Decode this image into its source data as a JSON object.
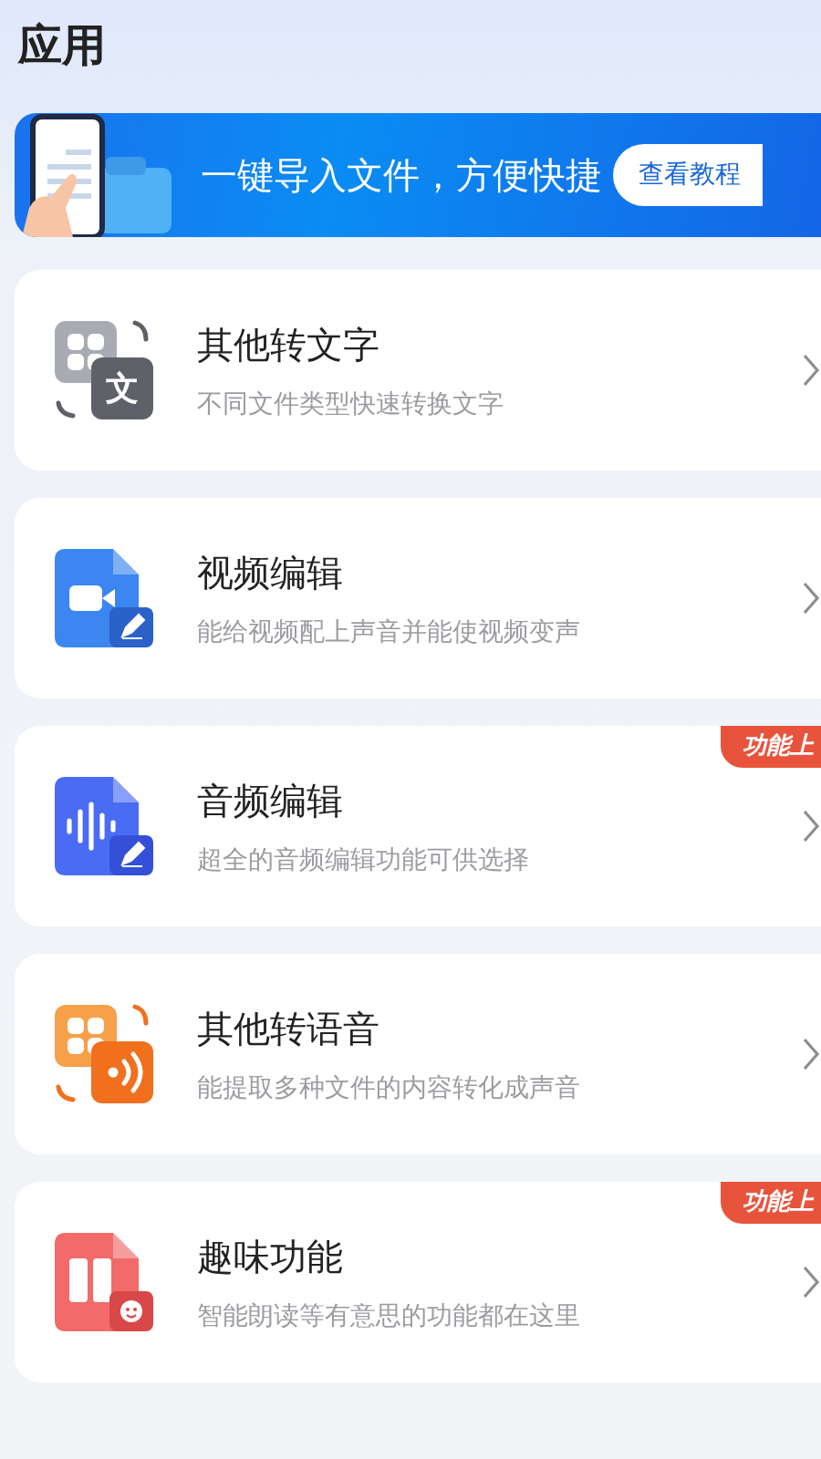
{
  "header": {
    "title": "应用"
  },
  "banner": {
    "text": "一键导入文件，方便快捷",
    "button": "查看教程"
  },
  "features": [
    {
      "kind": "convert-text",
      "title": "其他转文字",
      "subtitle": "不同文件类型快速转换文字",
      "icon_text": "文"
    },
    {
      "kind": "video",
      "title": "视频编辑",
      "subtitle": "能给视频配上声音并能使视频变声"
    },
    {
      "kind": "audio",
      "title": "音频编辑",
      "subtitle": "超全的音频编辑功能可供选择",
      "badge": "功能上"
    },
    {
      "kind": "convert-speech",
      "title": "其他转语音",
      "subtitle": "能提取多种文件的内容转化成声音"
    },
    {
      "kind": "fun",
      "title": "趣味功能",
      "subtitle": "智能朗读等有意思的功能都在这里",
      "badge": "功能上"
    }
  ]
}
